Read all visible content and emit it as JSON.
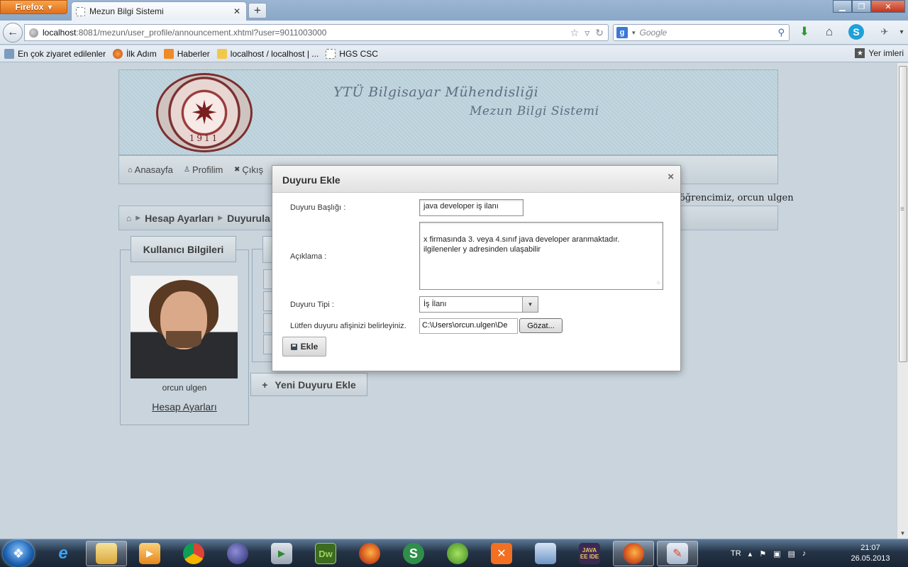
{
  "browser": {
    "app_button": "Firefox",
    "tab_title": "Mezun Bilgi Sistemi",
    "url_host": "localhost",
    "url_rest": ":8081/mezun/user_profile/announcement.xhtml?user=9011003000",
    "search_placeholder": "Google",
    "bookmarks": [
      "En çok ziyaret edilenler",
      "İlk Adım",
      "Haberler",
      "localhost / localhost | ...",
      "HGS CSC"
    ],
    "bookmarks_right": "Yer imleri"
  },
  "header": {
    "seal_year": "1911",
    "title_line1": "YTÜ Bilgisayar Mühendisliği",
    "title_line2": "Mezun Bilgi Sistemi"
  },
  "menu": {
    "home": "Anasayfa",
    "profile": "Profilim",
    "logout": "Çıkış"
  },
  "welcome_text": "öğrencimiz, orcun ulgen",
  "breadcrumb": [
    "Hesap Ayarları",
    "Duyurula"
  ],
  "user_panel": {
    "title": "Kullanıcı Bilgileri",
    "name": "orcun ulgen",
    "link": "Hesap Ayarları"
  },
  "new_announcement_button": "Yeni Duyuru Ekle",
  "dialog": {
    "title": "Duyuru Ekle",
    "close": "×",
    "title_label": "Duyuru Başlığı :",
    "title_value": "java developer iş ilanı",
    "description_label": "Açıklama :",
    "description_value": "x firmasında 3. veya 4.sınıf java developer aranmaktadır.\nilgilenenler y adresinden ulaşabilir",
    "type_label": "Duyuru Tipi :",
    "type_value": "İş İlanı",
    "poster_label": "Lütfen duyuru afişinizi belirleyiniz.",
    "poster_path": "C:\\Users\\orcun.ulgen\\De",
    "browse_button": "Gözat...",
    "submit_button": "Ekle"
  },
  "taskbar": {
    "language": "TR",
    "time": "21:07",
    "date": "26.05.2013",
    "apps": [
      "internet-explorer",
      "explorer",
      "media-player",
      "chrome",
      "eclipse",
      "database-tool",
      "dreamweaver",
      "firefox",
      "sourcetree",
      "spring-tool",
      "xampp",
      "virtualbox",
      "java-ee-ide",
      "firefox-active",
      "paint"
    ]
  }
}
